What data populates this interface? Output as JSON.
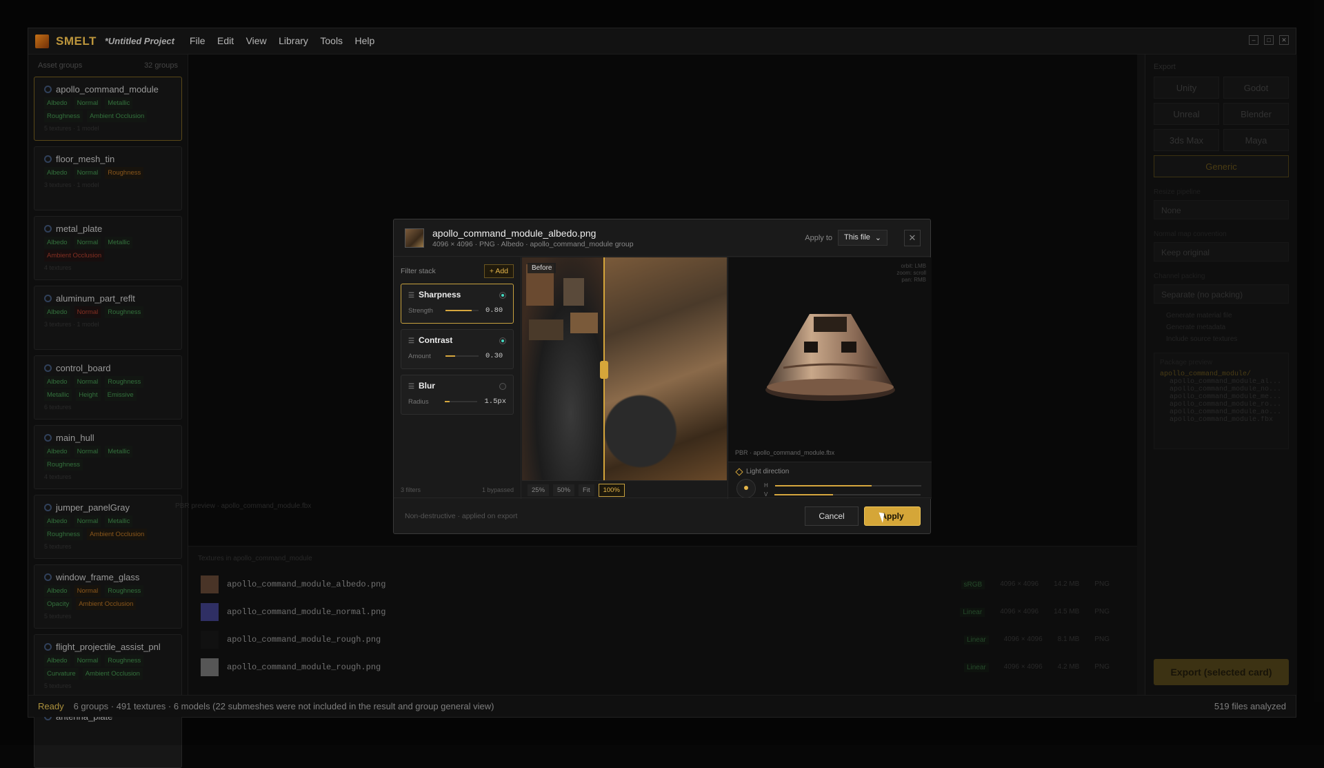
{
  "titlebar": {
    "app_name": "SMELT",
    "project": "*Untitled Project",
    "menu": [
      "File",
      "Edit",
      "View",
      "Library",
      "Tools",
      "Help"
    ]
  },
  "sidebar": {
    "header_label": "Asset groups",
    "header_count": "32 groups",
    "cards": [
      {
        "name": "apollo_command_module",
        "tags": [
          [
            "Albedo",
            "g"
          ],
          [
            "Normal",
            "g"
          ],
          [
            "Metallic",
            "g"
          ],
          [
            "Roughness",
            "g"
          ],
          [
            "Ambient Occlusion",
            "g"
          ]
        ],
        "sub": "5 textures · 1 model"
      },
      {
        "name": "floor_mesh_tin",
        "tags": [
          [
            "Albedo",
            "g"
          ],
          [
            "Normal",
            "g"
          ],
          [
            "Roughness",
            "o"
          ]
        ],
        "sub": "3 textures · 1 model"
      },
      {
        "name": "metal_plate",
        "tags": [
          [
            "Albedo",
            "g"
          ],
          [
            "Normal",
            "g"
          ],
          [
            "Metallic",
            "g"
          ],
          [
            "Ambient Occlusion",
            "r"
          ]
        ],
        "sub": "4 textures"
      },
      {
        "name": "aluminum_part_reflt",
        "tags": [
          [
            "Albedo",
            "g"
          ],
          [
            "Normal",
            "r"
          ],
          [
            "Roughness",
            "g"
          ]
        ],
        "sub": "3 textures · 1 model"
      },
      {
        "name": "control_board",
        "tags": [
          [
            "Albedo",
            "g"
          ],
          [
            "Normal",
            "g"
          ],
          [
            "Roughness",
            "g"
          ],
          [
            "Metallic",
            "g"
          ],
          [
            "Height",
            "g"
          ],
          [
            "Emissive",
            "g"
          ]
        ],
        "sub": "6 textures"
      },
      {
        "name": "main_hull",
        "tags": [
          [
            "Albedo",
            "g"
          ],
          [
            "Normal",
            "g"
          ],
          [
            "Metallic",
            "g"
          ],
          [
            "Roughness",
            "g"
          ]
        ],
        "sub": "4 textures"
      },
      {
        "name": "jumper_panelGray",
        "tags": [
          [
            "Albedo",
            "g"
          ],
          [
            "Normal",
            "g"
          ],
          [
            "Metallic",
            "g"
          ],
          [
            "Roughness",
            "g"
          ],
          [
            "Ambient Occlusion",
            "o"
          ]
        ],
        "sub": "5 textures"
      },
      {
        "name": "window_frame_glass",
        "tags": [
          [
            "Albedo",
            "g"
          ],
          [
            "Normal",
            "o"
          ],
          [
            "Roughness",
            "g"
          ],
          [
            "Opacity",
            "g"
          ],
          [
            "Ambient Occlusion",
            "o"
          ]
        ],
        "sub": "5 textures"
      },
      {
        "name": "flight_projectile_assist_pnl",
        "tags": [
          [
            "Albedo",
            "g"
          ],
          [
            "Normal",
            "g"
          ],
          [
            "Roughness",
            "g"
          ],
          [
            "Curvature",
            "g"
          ],
          [
            "Ambient Occlusion",
            "g"
          ]
        ],
        "sub": "5 textures"
      },
      {
        "name": "antenna_plate",
        "tags": [],
        "sub": ""
      }
    ]
  },
  "canvas": {
    "caption": "PBR preview · apollo_command_module.fbx"
  },
  "texlist": {
    "header": "Textures in apollo_command_module",
    "rows": [
      {
        "name": "apollo_command_module_albedo.png",
        "cs": "sRGB",
        "res": "4096 × 4096",
        "size": "14.2 MB",
        "fmt": "PNG",
        "thumb": "#5a4030"
      },
      {
        "name": "apollo_command_module_normal.png",
        "cs": "Linear",
        "res": "4096 × 4096",
        "size": "14.5 MB",
        "fmt": "PNG",
        "thumb": "#3a3a7a"
      },
      {
        "name": "apollo_command_module_rough.png",
        "cs": "Linear",
        "res": "4096 × 4096",
        "size": "8.1 MB",
        "fmt": "PNG",
        "thumb": "#151515"
      },
      {
        "name": "apollo_command_module_rough.png",
        "cs": "Linear",
        "res": "4096 × 4096",
        "size": "4.2 MB",
        "fmt": "PNG",
        "thumb": "#6a6a6a"
      }
    ]
  },
  "rightpanel": {
    "header": "Export",
    "engines": [
      "Unity",
      "Godot",
      "Unreal",
      "Blender",
      "3ds Max",
      "Maya"
    ],
    "engine_wide": "Generic",
    "resize_label": "Resize pipeline",
    "resize_value": "None",
    "normal_label": "Normal map convention",
    "normal_value": "Keep original",
    "packing_label": "Channel packing",
    "packing_value": "Separate (no packing)",
    "checks": [
      "Generate material file",
      "Generate metadata",
      "Include source textures"
    ],
    "pkg_header": "Package preview",
    "pkg_root": "apollo_command_module/",
    "pkg_files": [
      "apollo_command_module_al...",
      "apollo_command_module_no...",
      "apollo_command_module_me...",
      "apollo_command_module_ro...",
      "apollo_command_module_ao...",
      "apollo_command_module.fbx"
    ],
    "export_button": "Export (selected card)"
  },
  "statusbar": {
    "ready": "Ready",
    "text": "6 groups · 491 textures · 6 models (22 submeshes were not included in the result and group general view)",
    "right": "519 files analyzed"
  },
  "modal": {
    "title": "apollo_command_module_albedo.png",
    "subtitle": "4096 × 4096 · PNG · Albedo · apollo_command_module group",
    "apply_to_label": "Apply to",
    "apply_to_value": "This file",
    "filter_stack_label": "Filter stack",
    "add_label": "+ Add",
    "filters": [
      {
        "name": "Sharpness",
        "param": "Strength",
        "value": "0.80",
        "level": 0.8,
        "enabled": true,
        "selected": true
      },
      {
        "name": "Contrast",
        "param": "Amount",
        "value": "0.30",
        "level": 0.3,
        "enabled": true,
        "selected": false
      },
      {
        "name": "Blur",
        "param": "Radius",
        "value": "1.5px",
        "level": 0.15,
        "enabled": false,
        "selected": false
      }
    ],
    "filter_count": "3 filters",
    "bypassed": "1 bypassed",
    "before_label": "Before",
    "zoom": [
      "25%",
      "50%",
      "Fit",
      "100%"
    ],
    "zoom_selected": "100%",
    "pbr_hint": [
      "orbit: LMB",
      "zoom: scroll",
      "pan: RMB"
    ],
    "pbr_caption": "PBR · apollo_command_module.fbx",
    "light_label": "Light direction",
    "light_h": 0.66,
    "light_v": 0.4,
    "footer_note": "Non-destructive · applied on export",
    "cancel": "Cancel",
    "apply": "Apply"
  }
}
